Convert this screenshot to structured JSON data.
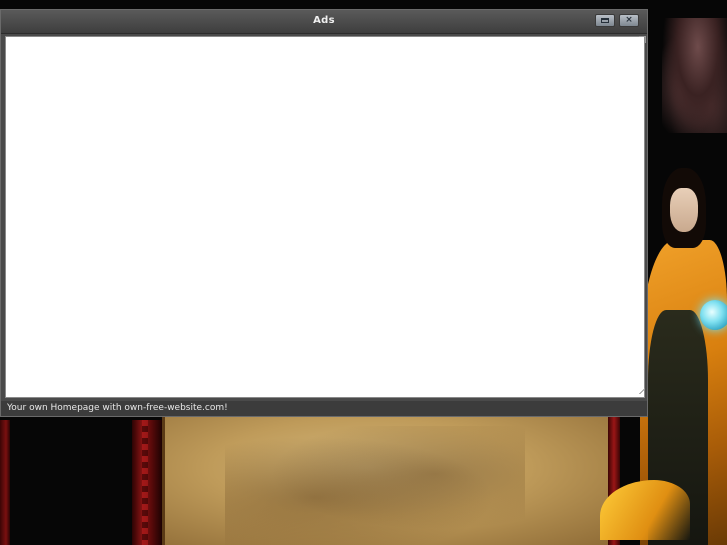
{
  "window": {
    "title": "Ads",
    "maximize_icon": "maximize-icon",
    "close_icon": "close-icon",
    "close_glyph": "×"
  },
  "statusbar": {
    "text": "Your own Homepage with own-free-website.com!"
  },
  "colors": {
    "titlebar": "#4a4a4a",
    "content_background": "#ffffff",
    "statusbar": "#3c3c3c",
    "game_gold": "#d9800f",
    "game_red": "#8a1414"
  }
}
